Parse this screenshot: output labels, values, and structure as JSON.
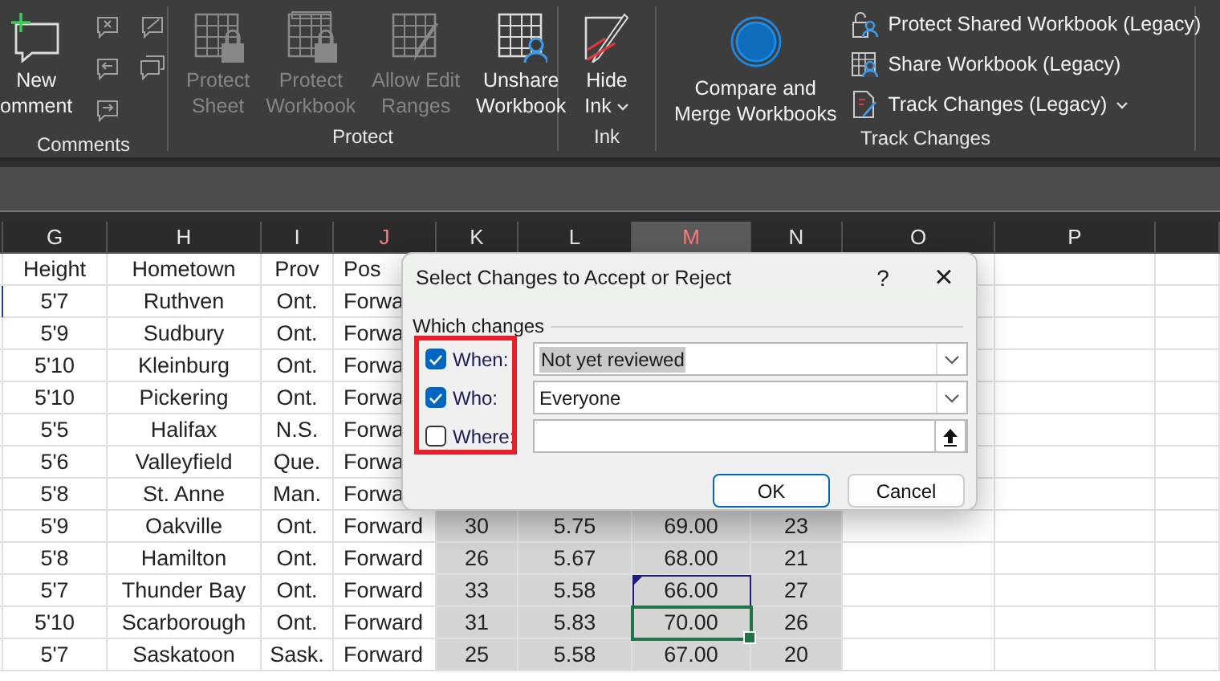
{
  "ribbon": {
    "groups": [
      {
        "label": "Comments",
        "buttons": [
          {
            "kind": "large",
            "lines": [
              "New",
              "omment"
            ],
            "disabled": false
          },
          {
            "kind": "icon",
            "disabled": true
          },
          {
            "kind": "icon",
            "disabled": true
          },
          {
            "kind": "icon",
            "disabled": true
          },
          {
            "kind": "icon",
            "disabled": true
          },
          {
            "kind": "icon",
            "disabled": true
          }
        ]
      },
      {
        "label": "Protect",
        "buttons": [
          {
            "kind": "large",
            "lines": [
              "Protect",
              "Sheet"
            ],
            "disabled": true
          },
          {
            "kind": "large",
            "lines": [
              "Protect",
              "Workbook"
            ],
            "disabled": true
          },
          {
            "kind": "large",
            "lines": [
              "Allow Edit",
              "Ranges"
            ],
            "disabled": true
          },
          {
            "kind": "large",
            "lines": [
              "Unshare",
              "Workbook"
            ],
            "disabled": false
          }
        ]
      },
      {
        "label": "Ink",
        "buttons": [
          {
            "kind": "large",
            "lines": [
              "Hide",
              "Ink"
            ],
            "menu": true,
            "disabled": false
          }
        ]
      },
      {
        "label": "Track Changes",
        "buttons": [
          {
            "kind": "large",
            "lines": [
              "Compare and",
              "Merge Workbooks"
            ],
            "disabled": false
          },
          {
            "kind": "row",
            "label": "Protect Shared Workbook (Legacy)",
            "disabled": false
          },
          {
            "kind": "row",
            "label": "Share Workbook (Legacy)",
            "disabled": false
          },
          {
            "kind": "row",
            "label": "Track Changes (Legacy)",
            "menu": true,
            "disabled": false
          }
        ]
      }
    ]
  },
  "sheet": {
    "columns": [
      {
        "label": "G",
        "selected": false,
        "tracked": false
      },
      {
        "label": "H",
        "selected": false,
        "tracked": false
      },
      {
        "label": "I",
        "selected": false,
        "tracked": false
      },
      {
        "label": "J",
        "selected": false,
        "tracked": true
      },
      {
        "label": "K",
        "selected": false,
        "tracked": false
      },
      {
        "label": "L",
        "selected": false,
        "tracked": false
      },
      {
        "label": "M",
        "selected": true,
        "tracked": true
      },
      {
        "label": "N",
        "selected": false,
        "tracked": false
      },
      {
        "label": "O",
        "selected": false,
        "tracked": false
      },
      {
        "label": "P",
        "selected": false,
        "tracked": false
      }
    ],
    "rows": [
      {
        "cells": [
          "Height",
          "Hometown",
          "Prov",
          "Pos"
        ]
      },
      {
        "cells": [
          "5'7",
          "Ruthven",
          "Ont.",
          "Forwa"
        ]
      },
      {
        "cells": [
          "5'9",
          "Sudbury",
          "Ont.",
          "Forwa"
        ]
      },
      {
        "cells": [
          "5'10",
          "Kleinburg",
          "Ont.",
          "Forwa"
        ]
      },
      {
        "cells": [
          "5'10",
          "Pickering",
          "Ont.",
          "Forwa"
        ]
      },
      {
        "cells": [
          "5'5",
          "Halifax",
          "N.S.",
          "Forwa"
        ]
      },
      {
        "cells": [
          "5'6",
          "Valleyfield",
          "Que.",
          "Forwa"
        ]
      },
      {
        "cells": [
          "5'8",
          "St. Anne",
          "Man.",
          "Forwa"
        ]
      },
      {
        "cells": [
          "5'9",
          "Oakville",
          "Ont.",
          "Forward",
          "30",
          "5.75",
          "69.00",
          "23"
        ],
        "selected": true,
        "marked": false,
        "current": false
      },
      {
        "cells": [
          "5'8",
          "Hamilton",
          "Ont.",
          "Forward",
          "26",
          "5.67",
          "68.00",
          "21"
        ],
        "selected": true,
        "marked": false,
        "current": false
      },
      {
        "cells": [
          "5'7",
          "Thunder Bay",
          "Ont.",
          "Forward",
          "33",
          "5.58",
          "66.00",
          "27"
        ],
        "selected": true,
        "marked": true,
        "current": false
      },
      {
        "cells": [
          "5'10",
          "Scarborough",
          "Ont.",
          "Forward",
          "31",
          "5.83",
          "70.00",
          "26"
        ],
        "selected": true,
        "marked": false,
        "current": true
      },
      {
        "cells": [
          "5'7",
          "Saskatoon",
          "Sask.",
          "Forward",
          "25",
          "5.58",
          "67.00",
          "20"
        ],
        "selected": true,
        "marked": false,
        "current": false
      }
    ]
  },
  "dialog": {
    "title": "Select Changes to Accept or Reject",
    "help": "?",
    "close": "×",
    "section": "Which changes",
    "filters": [
      {
        "kind": "dropdown",
        "label": "When:",
        "checked": true,
        "value": "Not yet reviewed",
        "highlighted": true
      },
      {
        "kind": "dropdown",
        "label": "Who:",
        "checked": true,
        "value": "Everyone",
        "highlighted": false
      },
      {
        "kind": "range",
        "label": "Where:",
        "checked": false
      }
    ],
    "buttons": [
      {
        "label": "OK",
        "default": true
      },
      {
        "label": "Cancel",
        "default": false
      }
    ]
  }
}
